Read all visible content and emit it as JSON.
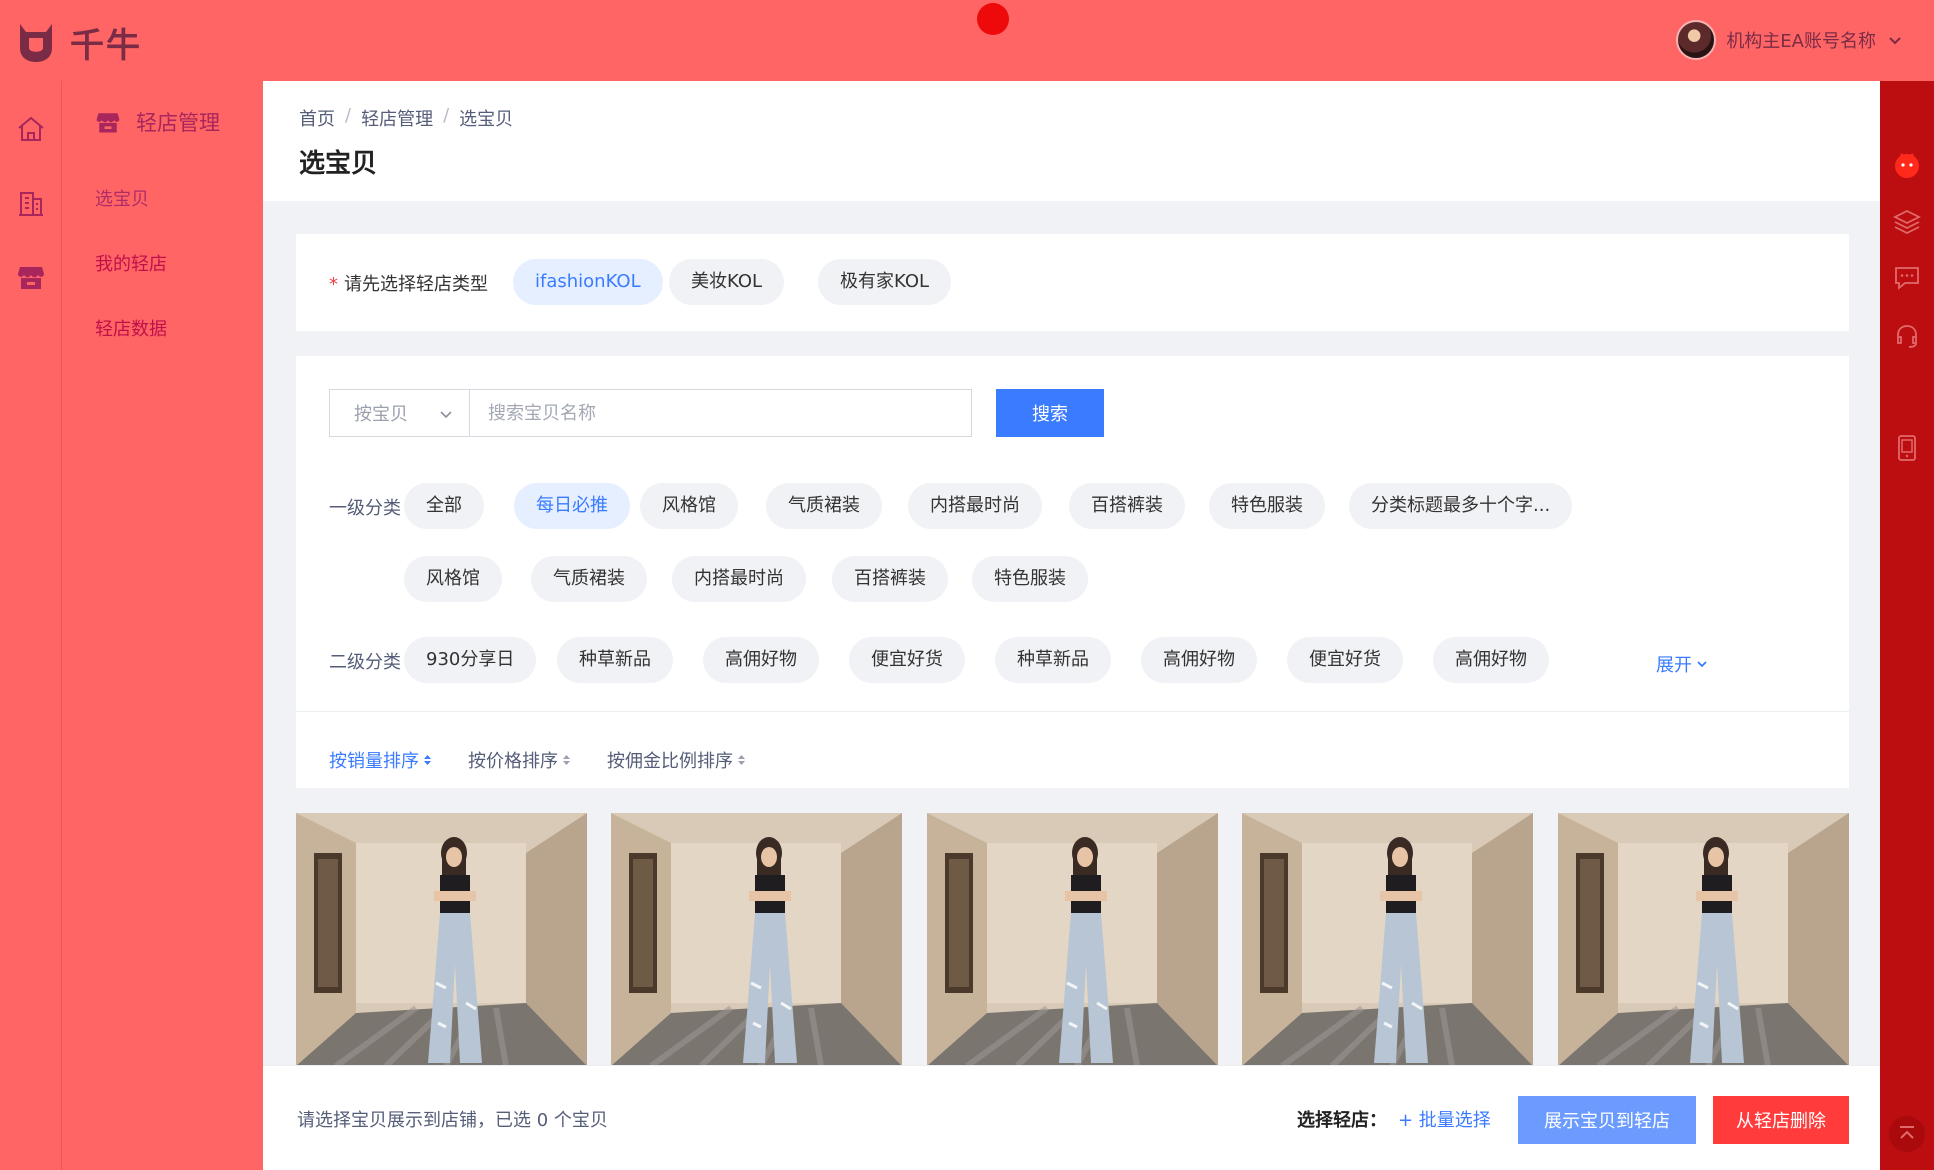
{
  "app": {
    "logo_text": "千牛"
  },
  "account": {
    "name": "机构主EA账号名称"
  },
  "colors": {
    "header": "#ff6565",
    "accent_blue": "#3a7bff",
    "right_rail": "#bc0d10",
    "danger": "#ff3b3b"
  },
  "rail": {
    "icons": [
      "home-icon",
      "building-icon",
      "shop-icon"
    ]
  },
  "right_rail": {
    "icons": [
      "mascot-icon",
      "layers-icon",
      "message-icon",
      "headset-icon",
      "phone-icon",
      "back-to-top-icon"
    ]
  },
  "subnav": {
    "title": "轻店管理",
    "items": [
      {
        "label": "选宝贝"
      },
      {
        "label": "我的轻店"
      },
      {
        "label": "轻店数据"
      }
    ]
  },
  "breadcrumb": [
    "首页",
    "轻店管理",
    "选宝贝"
  ],
  "page_title": "选宝贝",
  "shop_type": {
    "label": "请先选择轻店类型",
    "required_mark": "*",
    "options": [
      "ifashionKOL",
      "美妆KOL",
      "极有家KOL"
    ],
    "selected": "ifashionKOL"
  },
  "search": {
    "select_value": "按宝贝",
    "placeholder": "搜索宝贝名称",
    "button": "搜索"
  },
  "category1": {
    "label": "一级分类",
    "row1": [
      "全部",
      "每日必推",
      "风格馆",
      "气质裙装",
      "内搭最时尚",
      "百搭裤装",
      "特色服装",
      "分类标题最多十个字..."
    ],
    "row2": [
      "风格馆",
      "气质裙装",
      "内搭最时尚",
      "百搭裤装",
      "特色服装"
    ],
    "selected": "每日必推"
  },
  "category2": {
    "label": "二级分类",
    "items": [
      "930分享日",
      "种草新品",
      "高佣好物",
      "便宜好货",
      "种草新品",
      "高佣好物",
      "便宜好货",
      "高佣好物"
    ],
    "expand": "展开"
  },
  "sort": {
    "options": [
      "按销量排序",
      "按价格排序",
      "按佣金比例排序"
    ],
    "active": "按销量排序"
  },
  "products": {
    "count": 5
  },
  "bottom": {
    "status": "请选择宝贝展示到店铺，已选 0 个宝贝",
    "select_label": "选择轻店：",
    "batch": "+ 批量选择",
    "show_button": "展示宝贝到轻店",
    "delete_button": "从轻店删除"
  }
}
